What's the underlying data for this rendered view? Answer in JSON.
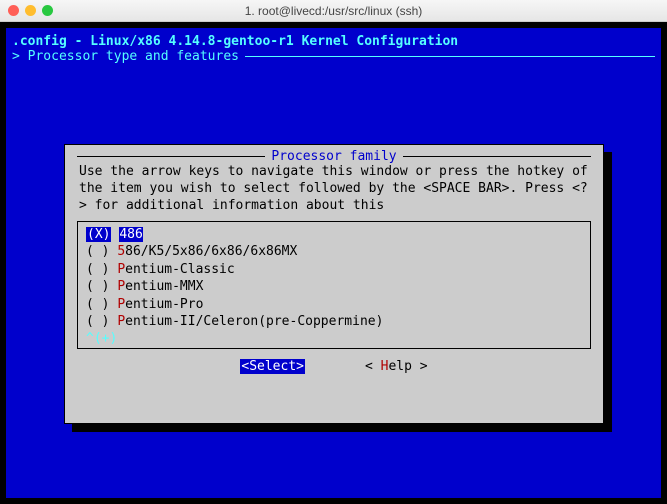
{
  "window": {
    "title": "1. root@livecd:/usr/src/linux (ssh)"
  },
  "header": {
    "config_line": ".config - Linux/x86 4.14.8-gentoo-r1 Kernel Configuration",
    "breadcrumb": "> Processor type and features"
  },
  "dialog": {
    "title": "Processor family",
    "instructions": "Use the arrow keys to navigate this window or press the hotkey of the item you wish to select followed by the <SPACE BAR>. Press <?> for additional information about this",
    "items": [
      {
        "radio": "(X)",
        "hotkey": "4",
        "label": "86",
        "selected": true
      },
      {
        "radio": "( )",
        "hotkey": "5",
        "label": "86/K5/5x86/6x86/6x86MX",
        "selected": false
      },
      {
        "radio": "( )",
        "hotkey": "P",
        "label": "entium-Classic",
        "selected": false
      },
      {
        "radio": "( )",
        "hotkey": "P",
        "label": "entium-MMX",
        "selected": false
      },
      {
        "radio": "( )",
        "hotkey": "P",
        "label": "entium-Pro",
        "selected": false
      },
      {
        "radio": "( )",
        "hotkey": "P",
        "label": "entium-II/Celeron(pre-Coppermine)",
        "selected": false
      }
    ],
    "more_indicator": "^(+)",
    "buttons": {
      "select": {
        "open": "<",
        "hot": "S",
        "rest": "elect",
        "close": ">"
      },
      "help": {
        "open": "< ",
        "hot": "H",
        "rest": "elp",
        "close": " >"
      }
    }
  }
}
